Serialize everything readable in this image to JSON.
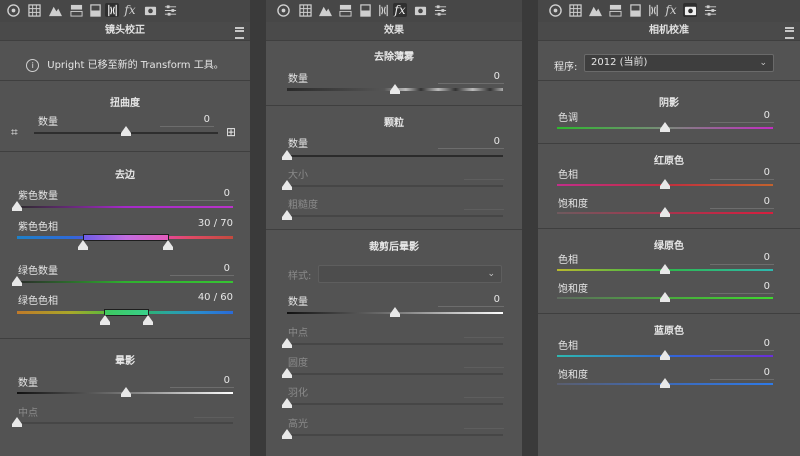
{
  "panels": [
    {
      "title": "镜头校正",
      "notice": "Upright 已移至新的 Transform 工具。",
      "distortion": {
        "title": "扭曲度",
        "amount_label": "数量",
        "amount_value": "0",
        "amount_level": 0.5
      },
      "defringe": {
        "title": "去边",
        "purple_amount_label": "紫色数量",
        "purple_amount_value": "0",
        "purple_hue_label": "紫色色相",
        "purple_hue_value": "30 / 70",
        "green_amount_label": "绿色数量",
        "green_amount_value": "0",
        "green_hue_label": "绿色色相",
        "green_hue_value": "40 / 60"
      },
      "vignette": {
        "title": "晕影",
        "amount_label": "数量",
        "amount_value": "0",
        "midpoint_label": "中点"
      }
    },
    {
      "title": "效果",
      "dehaze": {
        "title": "去除薄雾",
        "amount_label": "数量",
        "amount_value": "0"
      },
      "grain": {
        "title": "颗粒",
        "amount_label": "数量",
        "amount_value": "0",
        "size_label": "大小",
        "roughness_label": "粗糙度"
      },
      "post_crop_vignette": {
        "title": "裁剪后晕影",
        "style_label": "样式:",
        "amount_label": "数量",
        "amount_value": "0",
        "midpoint_label": "中点",
        "roundness_label": "圆度",
        "feather_label": "羽化",
        "highlights_label": "高光"
      }
    },
    {
      "title": "相机校准",
      "process_label": "程序:",
      "process_value": "2012 (当前)",
      "shadows": {
        "title": "阴影",
        "tint_label": "色调",
        "tint_value": "0"
      },
      "red_primary": {
        "title": "红原色",
        "hue_label": "色相",
        "hue_value": "0",
        "sat_label": "饱和度",
        "sat_value": "0"
      },
      "green_primary": {
        "title": "绿原色",
        "hue_label": "色相",
        "hue_value": "0",
        "sat_label": "饱和度",
        "sat_value": "0"
      },
      "blue_primary": {
        "title": "蓝原色",
        "hue_label": "色相",
        "hue_value": "0",
        "sat_label": "饱和度",
        "sat_value": "0"
      }
    }
  ],
  "toolbar_icons": [
    "aperture-icon",
    "grid-icon",
    "mountain-icon",
    "split-toning-icon",
    "hsl-icon",
    "lens-icon",
    "fx-icon",
    "camera-icon",
    "sliders-icon"
  ],
  "fx_glyph": "fx"
}
